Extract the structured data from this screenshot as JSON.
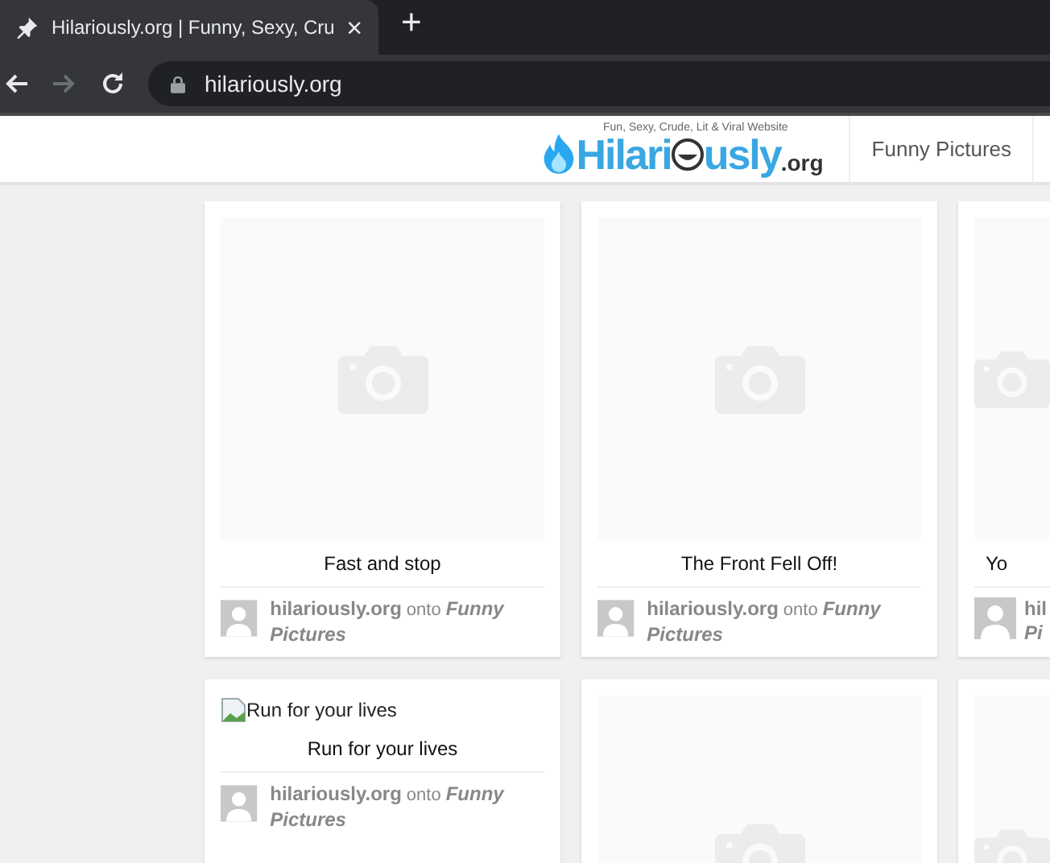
{
  "browser": {
    "tab": {
      "title": "Hilariously.org | Funny, Sexy, Cru",
      "close": "×",
      "pinned": true
    },
    "new_tab": "+",
    "back_enabled": true,
    "forward_enabled": false,
    "url": "hilariously.org"
  },
  "header": {
    "logo": {
      "tagline": "Fun, Sexy, Crude, Lit & Viral Website",
      "name_start": "Hilari",
      "name_end": "usly",
      "suffix": ".org"
    },
    "nav": [
      {
        "label": "Funny Pictures"
      }
    ]
  },
  "rows": [
    {
      "cards": [
        {
          "image": {
            "kind": "placeholder"
          },
          "title": "Fast and stop",
          "author": "hilariously.org",
          "connector": "onto",
          "board": "Funny Pictures"
        },
        {
          "image": {
            "kind": "placeholder"
          },
          "title": "The Front Fell Off!",
          "author": "hilariously.org",
          "connector": "onto",
          "board": "Funny Pictures"
        },
        {
          "image": {
            "kind": "placeholder"
          },
          "title": "Yo",
          "author": "hil",
          "board": "Pi",
          "cut_off": true
        }
      ]
    },
    {
      "cards": [
        {
          "image": {
            "kind": "broken",
            "alt": "Run for your lives"
          },
          "title": "Run for your lives",
          "author": "hilariously.org",
          "connector": "onto",
          "board": "Funny Pictures"
        },
        {
          "image": {
            "kind": "placeholder"
          }
        },
        {
          "image": {
            "kind": "placeholder"
          },
          "cut_off": true
        }
      ]
    }
  ]
}
